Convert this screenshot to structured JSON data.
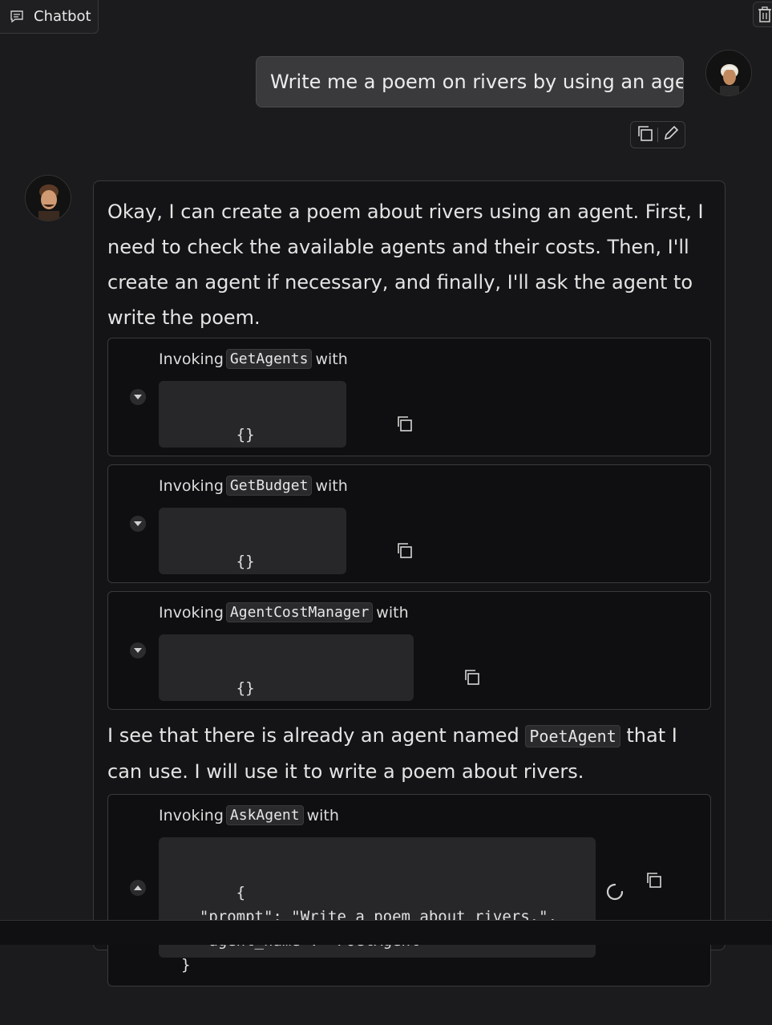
{
  "header": {
    "title": "Chatbot"
  },
  "user_message": {
    "text": "Write me a poem on rivers by using an agent\\"
  },
  "bot_message": {
    "intro": "Okay, I can create a poem about rivers using an agent. First, I need to check the available agents and their costs. Then, I'll create an agent if necessary, and finally, I'll ask the agent to write the poem.",
    "tool_calls": [
      {
        "prefix": "Invoking",
        "name": "GetAgents",
        "suffix": "with",
        "args": "{}"
      },
      {
        "prefix": "Invoking",
        "name": "GetBudget",
        "suffix": "with",
        "args": "{}"
      },
      {
        "prefix": "Invoking",
        "name": "AgentCostManager",
        "suffix": "with",
        "args": "{}"
      }
    ],
    "middle_text_before": "I see that there is already an agent named",
    "middle_code": "PoetAgent",
    "middle_text_after": "that I can use. I will use it to write a poem about rivers.",
    "final_tool": {
      "prefix": "Invoking",
      "name": "AskAgent",
      "suffix": "with",
      "args": "{\n  \"prompt\": \"Write a poem about rivers.\",\n  \"agent_name\": \"PoetAgent\"\n}"
    }
  },
  "colors": {
    "background": "#1b1b1d",
    "bubble_user": "#3a3a3d",
    "code_bg": "#27272a",
    "border": "#3a3a3d"
  }
}
